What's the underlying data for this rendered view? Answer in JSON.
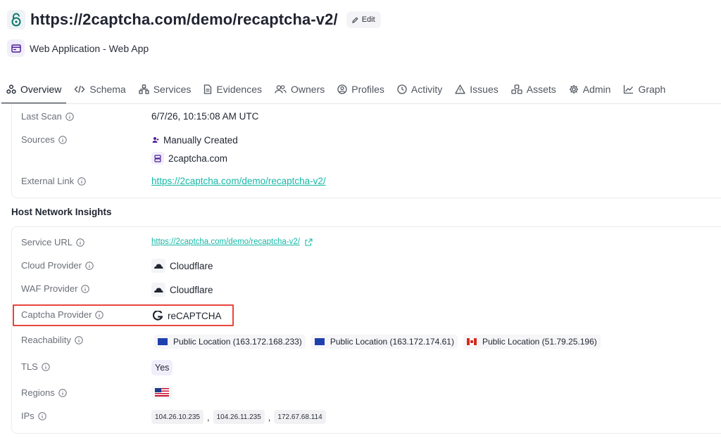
{
  "header": {
    "title": "https://2captcha.com/demo/recaptcha-v2/",
    "edit_label": "Edit",
    "subtitle": "Web Application - Web App"
  },
  "tabs": [
    {
      "label": "Overview",
      "icon": "overview-icon",
      "active": true
    },
    {
      "label": "Schema",
      "icon": "code-icon"
    },
    {
      "label": "Services",
      "icon": "services-icon"
    },
    {
      "label": "Evidences",
      "icon": "document-icon"
    },
    {
      "label": "Owners",
      "icon": "users-icon"
    },
    {
      "label": "Profiles",
      "icon": "profile-icon"
    },
    {
      "label": "Activity",
      "icon": "clock-icon"
    },
    {
      "label": "Issues",
      "icon": "warning-icon"
    },
    {
      "label": "Assets",
      "icon": "assets-icon"
    },
    {
      "label": "Admin",
      "icon": "gear-icon"
    },
    {
      "label": "Graph",
      "icon": "graph-icon"
    }
  ],
  "overview": {
    "last_scan_label": "Last Scan",
    "last_scan_value": "6/7/26, 10:15:08 AM UTC",
    "sources_label": "Sources",
    "sources": [
      "Manually Created",
      "2captcha.com"
    ],
    "external_link_label": "External Link",
    "external_link_value": "https://2captcha.com/demo/recaptcha-v2/"
  },
  "insights": {
    "section_title": "Host Network Insights",
    "service_url_label": "Service URL",
    "service_url_value": "https://2captcha.com/demo/recaptcha-v2/",
    "cloud_provider_label": "Cloud Provider",
    "cloud_provider_value": "Cloudflare",
    "waf_provider_label": "WAF Provider",
    "waf_provider_value": "Cloudflare",
    "captcha_provider_label": "Captcha Provider",
    "captcha_provider_value": "reCAPTCHA",
    "reachability_label": "Reachability",
    "reachability": [
      {
        "text": "Public Location (163.172.168.233)",
        "flag": "eu"
      },
      {
        "text": "Public Location (163.172.174.61)",
        "flag": "eu"
      },
      {
        "text": "Public Location (51.79.25.196)",
        "flag": "ca"
      }
    ],
    "tls_label": "TLS",
    "tls_value": "Yes",
    "regions_label": "Regions",
    "regions": [
      "us"
    ],
    "ips_label": "IPs",
    "ips": [
      "104.26.10.235",
      "104.26.11.235",
      "172.67.68.114"
    ],
    "ip_separator": ","
  },
  "colors": {
    "link": "#14b8a6",
    "highlight": "#e8453c",
    "active_tab": "#1f2430"
  }
}
